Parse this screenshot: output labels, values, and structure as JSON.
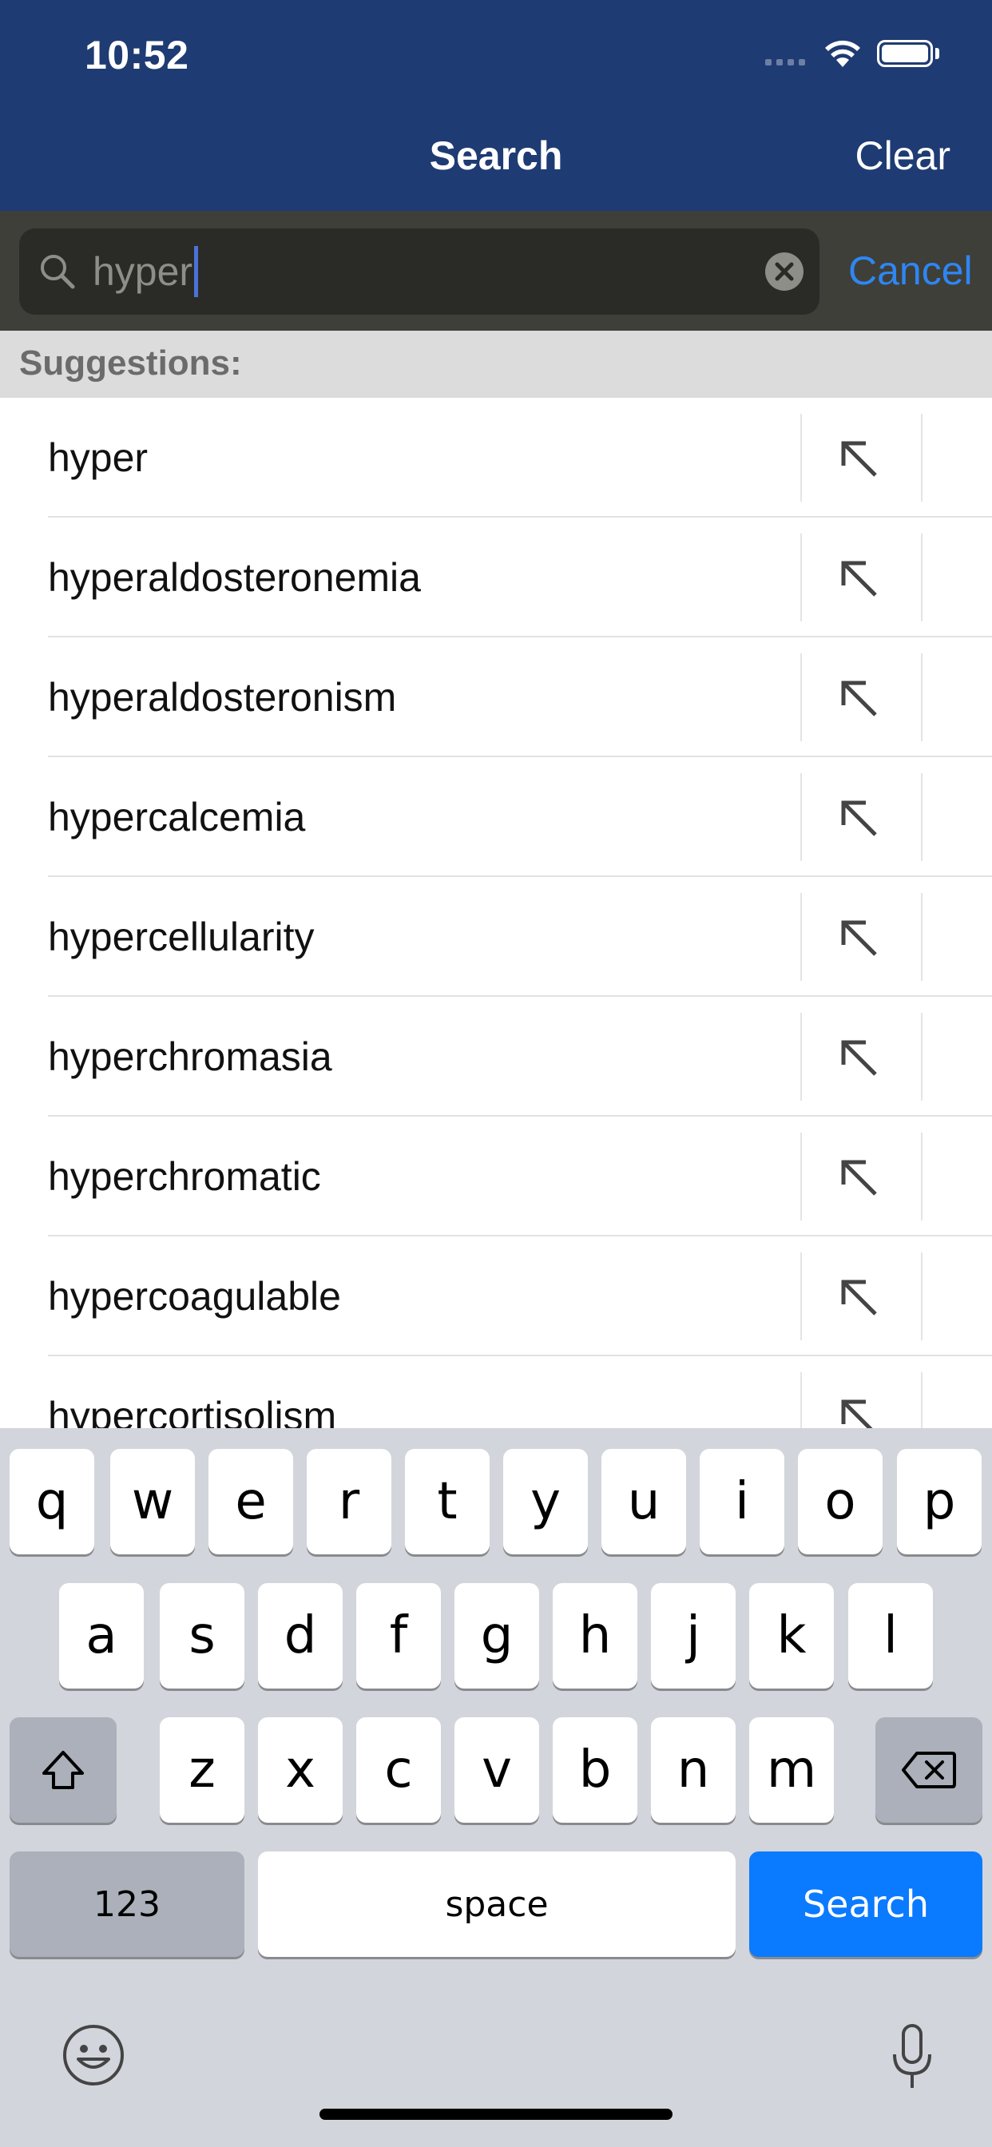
{
  "status_bar": {
    "time": "10:52"
  },
  "nav": {
    "title": "Search",
    "clear_label": "Clear"
  },
  "search": {
    "query": "hyper",
    "cancel_label": "Cancel"
  },
  "suggestions": {
    "header": "Suggestions:",
    "items": [
      "hyper",
      "hyperaldosteronemia",
      "hyperaldosteronism",
      "hypercalcemia",
      "hypercellularity",
      "hyperchromasia",
      "hyperchromatic",
      "hypercoagulable",
      "hypercortisolism"
    ]
  },
  "keyboard": {
    "row1": [
      "q",
      "w",
      "e",
      "r",
      "t",
      "y",
      "u",
      "i",
      "o",
      "p"
    ],
    "row2": [
      "a",
      "s",
      "d",
      "f",
      "g",
      "h",
      "j",
      "k",
      "l"
    ],
    "row3": [
      "z",
      "x",
      "c",
      "v",
      "b",
      "n",
      "m"
    ],
    "numbers_label": "123",
    "space_label": "space",
    "search_label": "Search"
  },
  "colors": {
    "nav_bg": "#1f3b73",
    "accent": "#2f86f2",
    "search_key": "#0a7aff"
  }
}
